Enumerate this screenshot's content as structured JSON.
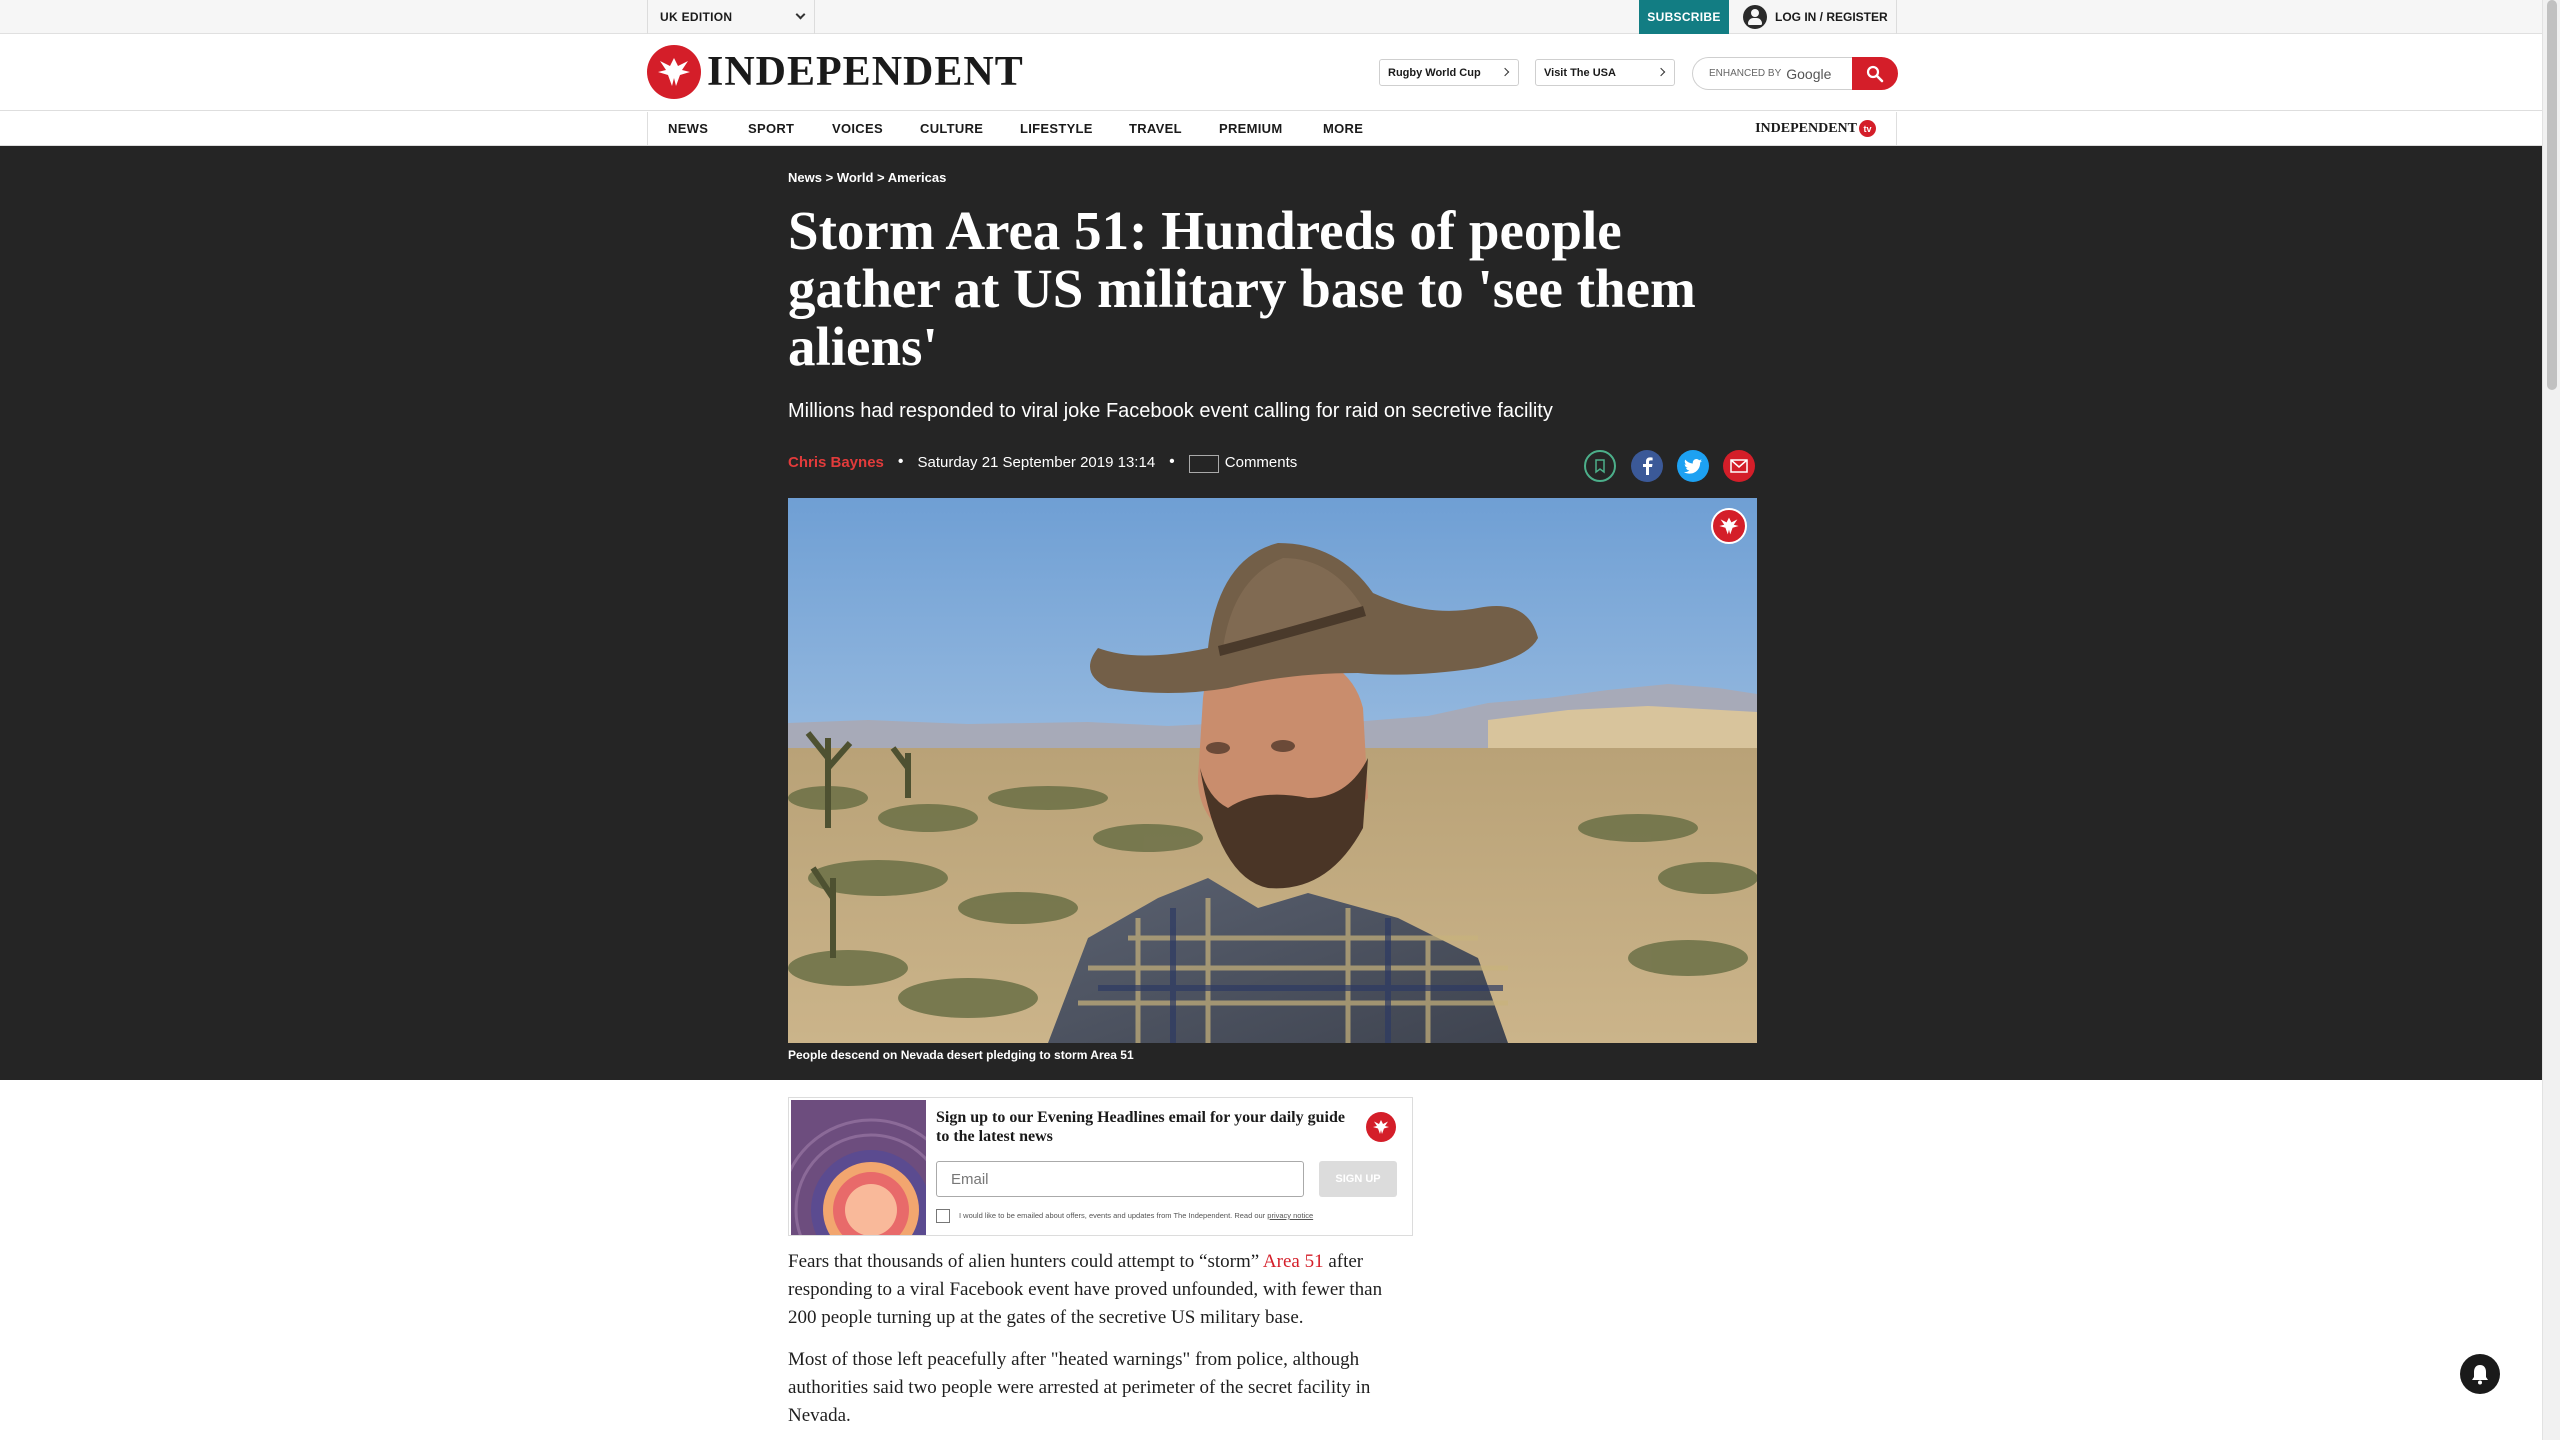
{
  "topbar": {
    "edition": "UK EDITION",
    "subscribe": "SUBSCRIBE",
    "login": "LOG IN / REGISTER"
  },
  "masthead": {
    "logo": "INDEPENDENT",
    "promo_1": "Rugby World Cup",
    "promo_2": "Visit The USA",
    "search_prefix": "ENHANCED BY",
    "search_brand": "Google"
  },
  "nav": {
    "items": [
      "NEWS",
      "SPORT",
      "VOICES",
      "CULTURE",
      "LIFESTYLE",
      "TRAVEL",
      "PREMIUM",
      "MORE"
    ],
    "tv_logo": "INDEPENDENT",
    "tv_badge": "tv"
  },
  "article": {
    "breadcrumb": [
      "News",
      "World",
      "Americas"
    ],
    "breadcrumb_sep": ">",
    "headline": "Storm Area 51: Hundreds of people gather at US military base to 'see them aliens'",
    "standfirst": "Millions had responded to viral joke Facebook event calling for raid on secretive facility",
    "author": "Chris Baynes",
    "date": "Saturday 21 September 2019 13:14",
    "comments": "Comments",
    "caption": "People descend on Nevada desert pledging to storm Area 51"
  },
  "newsletter": {
    "title": "Sign up to our Evening Headlines email for your daily guide to the latest news",
    "email_placeholder": "Email",
    "signup": "SIGN UP",
    "consent": "I would like to be emailed about offers, events and updates from The Independent. Read our",
    "privacy": "privacy notice"
  },
  "body": {
    "p1_before": "Fears that thousands of alien hunters could attempt to “storm”",
    "p1_link": "Area 51",
    "p1_after": "after responding to a viral Facebook event have proved unfounded, with fewer than 200 people turning up at the gates of the secretive US military base.",
    "p2": "Most of those left peacefully after \"heated warnings\" from police, although authorities said two people were arrested at perimeter of the secret facility in Nevada."
  },
  "colors": {
    "brand_red": "#d41e29",
    "subscribe_teal": "#127d83",
    "hero_bg": "#252525",
    "facebook": "#3b5998",
    "twitter": "#1da1f2"
  },
  "icons": [
    "chevron-down-icon",
    "user-icon",
    "eagle-logo-icon",
    "search-icon",
    "bookmark-icon",
    "facebook-icon",
    "twitter-icon",
    "email-icon",
    "comment-icon",
    "bell-icon"
  ]
}
